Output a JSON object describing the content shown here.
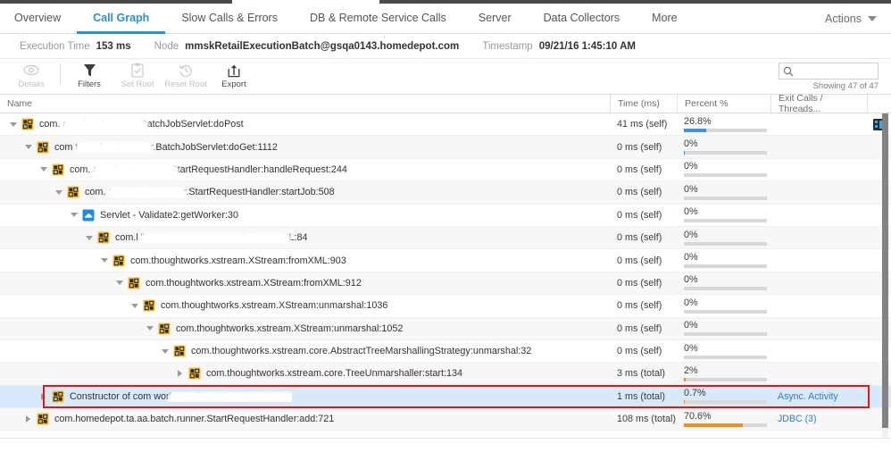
{
  "tabs": [
    {
      "label": "Overview",
      "active": false
    },
    {
      "label": "Call Graph",
      "active": true
    },
    {
      "label": "Slow Calls & Errors",
      "active": false
    },
    {
      "label": "DB & Remote Service Calls",
      "active": false
    },
    {
      "label": "Server",
      "active": false
    },
    {
      "label": "Data Collectors",
      "active": false
    },
    {
      "label": "More",
      "active": false
    }
  ],
  "actions": {
    "label": "Actions"
  },
  "summary": {
    "execution_time_label": "Execution Time",
    "execution_time_value": "153 ms",
    "node_label": "Node",
    "node_value": "mmskRetailExecutionBatch@gsqa0143.homedepot.com",
    "timestamp_label": "Timestamp",
    "timestamp_value": "09/21/16 1:45:10 AM"
  },
  "toolbar": {
    "details": "Details",
    "filters": "Filters",
    "set_root": "Set Root",
    "reset_root": "Reset Root",
    "export": "Export"
  },
  "search": {
    "value": "",
    "placeholder": ""
  },
  "showing": "Showing 47 of 47",
  "columns": {
    "name": "Name",
    "time": "Time (ms)",
    "percent": "Percent %",
    "exit": "Exit Calls / Threads...",
    "icon": ""
  },
  "colors": {
    "accent_blue": "#2a8fe0",
    "bar_blue": "#3d90e8",
    "bar_orange": "#f09020",
    "highlight_red": "#e81313",
    "selected_row": "#d7e9fb",
    "link_blue": "#2f7fd0"
  },
  "rows": [
    {
      "depth": 0,
      "twisty": "down",
      "icon": "method-icon",
      "label": "com.                                a.aa.batch.runner.BatchJobServlet:doPost",
      "redactions": [
        [
          28,
          92
        ]
      ],
      "time": "41 ms (self)",
      "percent": "26.8%",
      "bar": 26.8,
      "bar_color": "blue",
      "exit": "",
      "alt": false,
      "selected": false,
      "redbox": false,
      "panel_icon": true
    },
    {
      "depth": 1,
      "twisty": "down",
      "icon": "method-icon",
      "label": "com                             ta.aa.batch.runner.BatchJobServlet:doGet:1112",
      "redactions": [
        [
          25,
          84
        ]
      ],
      "time": "0 ms (self)",
      "percent": "0%",
      "bar": 0.6,
      "bar_color": "blue",
      "exit": "",
      "alt": true,
      "selected": false,
      "redbox": false,
      "panel_icon": false
    },
    {
      "depth": 2,
      "twisty": "down",
      "icon": "method-icon",
      "label": "com.                             a.aa.batch.runner.StartRequestHandler:handleRequest:244",
      "redactions": [
        [
          28,
          92
        ]
      ],
      "time": "0 ms (self)",
      "percent": "0%",
      "bar": 0,
      "bar_color": "blue",
      "exit": "",
      "alt": false,
      "selected": false,
      "redbox": false,
      "panel_icon": false
    },
    {
      "depth": 3,
      "twisty": "down",
      "icon": "method-icon",
      "label": "com.                             :a.aa.batch.runner.StartRequestHandler:startJob:508",
      "redactions": [
        [
          28,
          84
        ]
      ],
      "time": "0 ms (self)",
      "percent": "0%",
      "bar": 0,
      "bar_color": "blue",
      "exit": "",
      "alt": true,
      "selected": false,
      "redbox": false,
      "panel_icon": false
    },
    {
      "depth": 4,
      "twisty": "down",
      "icon": "servlet-icon",
      "label": "Servlet - Validate2:getWorker:30",
      "redactions": [],
      "time": "0 ms (self)",
      "percent": "0%",
      "bar": 0,
      "bar_color": "blue",
      "exit": "",
      "alt": false,
      "selected": false,
      "redbox": false,
      "panel_icon": false
    },
    {
      "depth": 5,
      "twisty": "down",
      "icon": "method-icon",
      "label": "com.l                                                      \"MLGenerator:generateTOfromXML:84",
      "redactions": [
        [
          30,
          165
        ]
      ],
      "time": "0 ms (self)",
      "percent": "0%",
      "bar": 0,
      "bar_color": "blue",
      "exit": "",
      "alt": true,
      "selected": false,
      "redbox": false,
      "panel_icon": false
    },
    {
      "depth": 6,
      "twisty": "down",
      "icon": "method-icon",
      "label": "com.thoughtworks.xstream.XStream:fromXML:903",
      "redactions": [],
      "time": "0 ms (self)",
      "percent": "0%",
      "bar": 0,
      "bar_color": "blue",
      "exit": "",
      "alt": false,
      "selected": false,
      "redbox": false,
      "panel_icon": false
    },
    {
      "depth": 7,
      "twisty": "down",
      "icon": "method-icon",
      "label": "com.thoughtworks.xstream.XStream:fromXML:912",
      "redactions": [],
      "time": "0 ms (self)",
      "percent": "0%",
      "bar": 0,
      "bar_color": "blue",
      "exit": "",
      "alt": true,
      "selected": false,
      "redbox": false,
      "panel_icon": false
    },
    {
      "depth": 8,
      "twisty": "down",
      "icon": "method-icon",
      "label": "com.thoughtworks.xstream.XStream:unmarshal:1036",
      "redactions": [],
      "time": "0 ms (self)",
      "percent": "0%",
      "bar": 0,
      "bar_color": "blue",
      "exit": "",
      "alt": false,
      "selected": false,
      "redbox": false,
      "panel_icon": false
    },
    {
      "depth": 9,
      "twisty": "down",
      "icon": "method-icon",
      "label": "com.thoughtworks.xstream.XStream:unmarshal:1052",
      "redactions": [],
      "time": "0 ms (self)",
      "percent": "0%",
      "bar": 0,
      "bar_color": "blue",
      "exit": "",
      "alt": true,
      "selected": false,
      "redbox": false,
      "panel_icon": false
    },
    {
      "depth": 10,
      "twisty": "down",
      "icon": "method-icon",
      "label": "com.thoughtworks.xstream.core.AbstractTreeMarshallingStrategy:unmarshal:32",
      "redactions": [],
      "time": "0 ms (self)",
      "percent": "0%",
      "bar": 0,
      "bar_color": "blue",
      "exit": "",
      "alt": false,
      "selected": false,
      "redbox": false,
      "panel_icon": false
    },
    {
      "depth": 11,
      "twisty": "right",
      "icon": "method-icon",
      "label": "com.thoughtworks.xstream.core.TreeUnmarshaller:start:134",
      "redactions": [],
      "time": "3 ms (total)",
      "percent": "2%",
      "bar": 2,
      "bar_color": "orange",
      "exit": "",
      "alt": true,
      "selected": false,
      "redbox": false,
      "panel_icon": false
    },
    {
      "depth": 2,
      "twisty": "right",
      "icon": "method-icon",
      "label": "Constructor of com                                      worker.ValidateParentWorker:32",
      "redactions": [
        [
          112,
          150
        ]
      ],
      "time": "1 ms (total)",
      "percent": "0.7%",
      "bar": 1.2,
      "bar_color": "orange",
      "exit": "Async. Activity",
      "alt": false,
      "selected": true,
      "redbox": true,
      "panel_icon": false
    },
    {
      "depth": 1,
      "twisty": "right",
      "icon": "method-icon",
      "label": "com.homedepot.ta.aa.batch.runner.StartRequestHandler:add:721",
      "redactions": [],
      "time": "108 ms (total)",
      "percent": "70.6%",
      "bar": 70.6,
      "bar_color": "orange",
      "exit": "JDBC (3)",
      "alt": true,
      "selected": false,
      "redbox": false,
      "panel_icon": false
    }
  ]
}
